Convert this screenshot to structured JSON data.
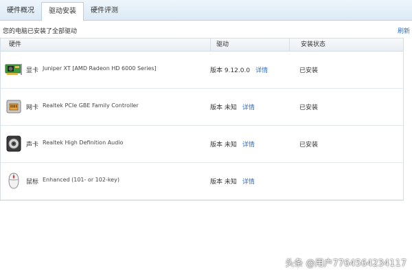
{
  "tabs": [
    {
      "label": "硬件概况"
    },
    {
      "label": "驱动安装"
    },
    {
      "label": "硬件评测"
    }
  ],
  "notice": "您的电脑已安装了全部驱动",
  "refresh_label": "刷新",
  "table": {
    "headers": [
      "硬件",
      "驱动",
      "安装状态"
    ],
    "rows": [
      {
        "type": "显卡",
        "name": "Juniper XT [AMD Radeon HD 6000 Series]",
        "version": "版本 9.12.0.0",
        "details": "详情",
        "status": "已安装",
        "icon": "graphics-card-icon"
      },
      {
        "type": "网卡",
        "name": "Realtek PCIe GBE Family Controller",
        "version": "版本 未知",
        "details": "详情",
        "status": "已安装",
        "icon": "network-card-icon"
      },
      {
        "type": "声卡",
        "name": "Realtek High Definition Audio",
        "version": "版本 未知",
        "details": "详情",
        "status": "已安装",
        "icon": "speaker-icon"
      },
      {
        "type": "鼠标",
        "name": "Enhanced (101- or 102-key)",
        "version": "版本 未知",
        "details": "详情",
        "status": "",
        "icon": "mouse-icon"
      }
    ]
  },
  "watermark": "头条 @用户7764564234117",
  "colors": {
    "accent_link": "#2f6fbf",
    "tab_bg": "#dce9f5",
    "border": "#d5dde6"
  }
}
